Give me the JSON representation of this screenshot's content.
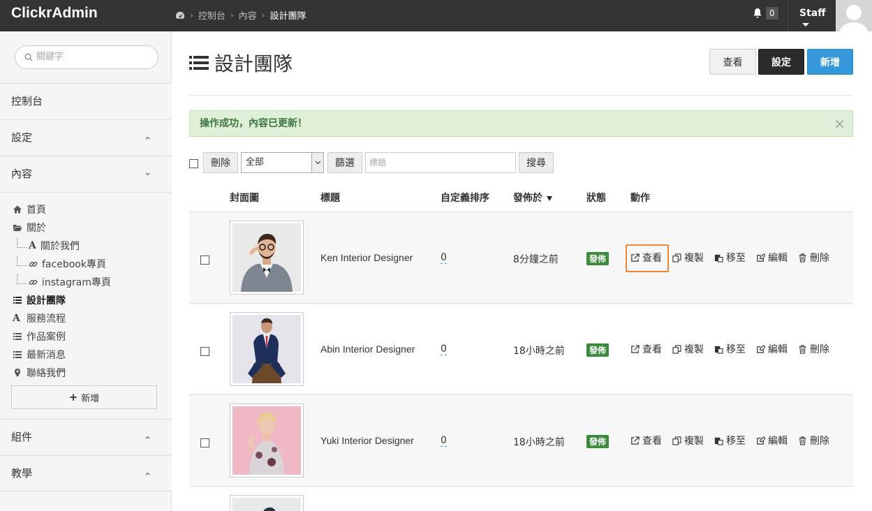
{
  "topbar": {
    "brand": "ClickrAdmin",
    "breadcrumb": [
      "控制台",
      "內容",
      "設計團隊"
    ],
    "notification_count": "0",
    "user_label": "Staff"
  },
  "sidebar": {
    "search_placeholder": "關鍵字",
    "sections": {
      "dashboard": "控制台",
      "settings": "設定",
      "content": "內容",
      "components": "組件",
      "tutorials": "教學"
    },
    "nav": {
      "home": "首頁",
      "about": "關於",
      "about_us": "關於我們",
      "facebook": "facebook專頁",
      "instagram": "instagram專頁",
      "design_team": "設計團隊",
      "service_flow": "服務流程",
      "portfolio": "作品案例",
      "news": "最新消息",
      "contact": "聯絡我們"
    },
    "add_label": "新增"
  },
  "main": {
    "title": "設計團隊",
    "buttons": {
      "view": "查看",
      "settings": "設定",
      "new": "新增"
    },
    "alert": "操作成功，內容已更新！",
    "alert_close": "×",
    "toolbar": {
      "delete": "刪除",
      "filter_value": "全部",
      "filter_btn": "篩選",
      "title_placeholder": "標題",
      "search_btn": "搜尋"
    },
    "columns": {
      "cover": "封面圖",
      "title": "標題",
      "order": "自定義排序",
      "published": "發佈於",
      "status": "狀態",
      "actions": "動作"
    },
    "actions": {
      "view": "查看",
      "copy": "複製",
      "move": "移至",
      "edit": "編輯",
      "delete": "刪除"
    },
    "rows": [
      {
        "title": "Ken Interior Designer",
        "order": "0",
        "time": "8分鐘之前",
        "status": "發佈"
      },
      {
        "title": "Abin Interior Designer",
        "order": "0",
        "time": "18小時之前",
        "status": "發佈"
      },
      {
        "title": "Yuki Interior Designer",
        "order": "0",
        "time": "18小時之前",
        "status": "發佈"
      }
    ]
  },
  "colors": {
    "topbar_bg": "#333333",
    "primary_blue": "#3498db",
    "dark_button": "#2b2b2b",
    "success_bg": "#dff0d8",
    "success_text": "#3c763d",
    "badge_green": "#3c8a3c",
    "highlight_orange": "#f0883a"
  }
}
